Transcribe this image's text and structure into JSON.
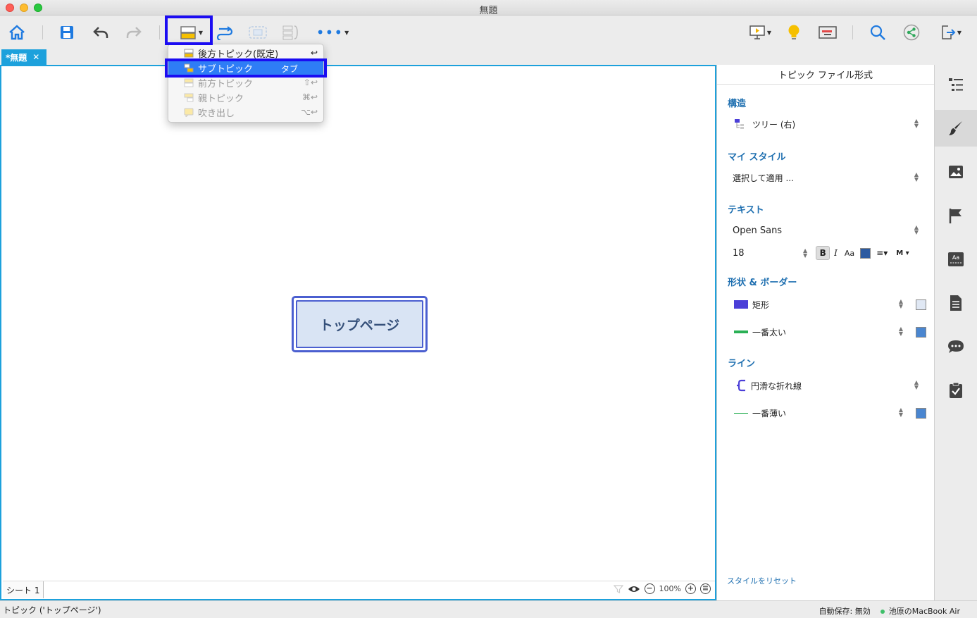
{
  "window": {
    "title": "無題"
  },
  "tabs": {
    "active": "*無題",
    "close": "✕"
  },
  "topic": {
    "label": "トップページ"
  },
  "menu": {
    "items": [
      {
        "label": "後方トピック(既定)",
        "key": "↩",
        "state": "normal"
      },
      {
        "label": "サブトピック",
        "key": "タブ",
        "state": "selected"
      },
      {
        "label": "前方トピック",
        "key": "⇧↩",
        "state": "disabled"
      },
      {
        "label": "親トピック",
        "key": "⌘↩",
        "state": "disabled"
      },
      {
        "label": "吹き出し",
        "key": "⌥↩",
        "state": "disabled"
      }
    ]
  },
  "panel": {
    "title": "トピック ファイル形式",
    "structure": {
      "heading": "構造",
      "value": "ツリー (右)"
    },
    "mystyle": {
      "heading": "マイ スタイル",
      "value": "選択して適用 ..."
    },
    "text": {
      "heading": "テキスト",
      "font": "Open Sans",
      "size": "18",
      "bold": "B",
      "italic": "I",
      "case": "Aa",
      "more": "M"
    },
    "shape": {
      "heading": "形状 & ボーダー",
      "shape": "矩形",
      "border": "一番太い"
    },
    "line": {
      "heading": "ライン",
      "style": "円滑な折れ線",
      "weight": "一番薄い"
    },
    "reset": "スタイルをリセット"
  },
  "sheet": {
    "name": "シート 1",
    "zoom": "100%"
  },
  "status": {
    "left": "トピック ('トップページ')",
    "autosave": "自動保存: 無効",
    "device": "池原のMacBook Air"
  },
  "colors": {
    "accent": "#1da1dc",
    "topic_border": "#4b5fd0",
    "topic_fill": "#d9e4f4",
    "highlight": "#1b0cf2",
    "menu_selected": "#2e7df6"
  }
}
